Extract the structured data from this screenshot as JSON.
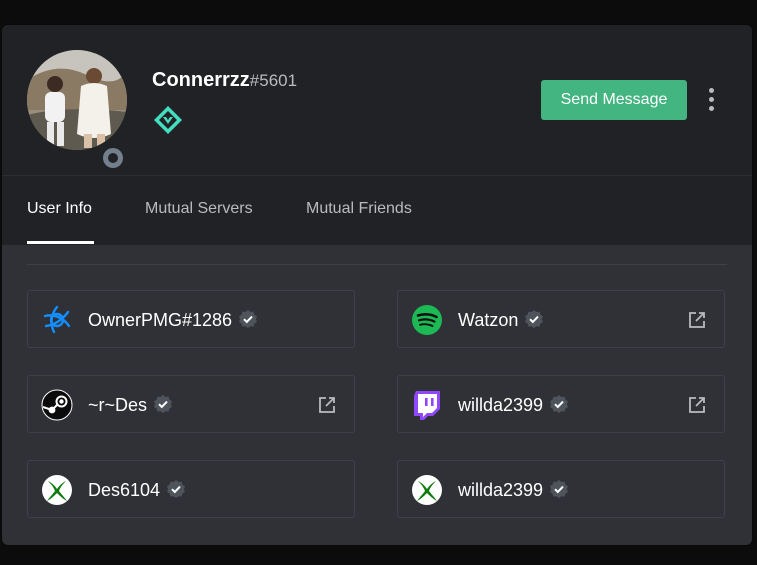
{
  "user": {
    "username": "Connerrzz",
    "discriminator": "#5601",
    "status": "offline",
    "badge_icon": "hypesquad-balance-icon"
  },
  "actions": {
    "send_message_label": "Send Message",
    "send_message_color": "#43b581"
  },
  "tabs": [
    {
      "label": "User Info",
      "active": true
    },
    {
      "label": "Mutual Servers",
      "active": false
    },
    {
      "label": "Mutual Friends",
      "active": false
    }
  ],
  "connections": [
    {
      "platform": "battlenet",
      "icon": "battlenet-icon",
      "name": "OwnerPMG#1286",
      "verified": true,
      "external_link": false
    },
    {
      "platform": "spotify",
      "icon": "spotify-icon",
      "name": "Watzon",
      "verified": true,
      "external_link": true
    },
    {
      "platform": "steam",
      "icon": "steam-icon",
      "name": "~r~Des",
      "verified": true,
      "external_link": true
    },
    {
      "platform": "twitch",
      "icon": "twitch-icon",
      "name": "willda2399",
      "verified": true,
      "external_link": true
    },
    {
      "platform": "xbox",
      "icon": "xbox-icon",
      "name": "Des6104",
      "verified": true,
      "external_link": false
    },
    {
      "platform": "xbox",
      "icon": "xbox-icon",
      "name": "willda2399",
      "verified": true,
      "external_link": false
    }
  ],
  "colors": {
    "header_bg": "#202225",
    "body_bg": "#2f3136",
    "card_border": "#3e4147",
    "spotify": "#1db954",
    "twitch": "#9146ff",
    "battlenet": "#148eff",
    "xbox": "#107c10",
    "hypesquad_balance": "#45ddc0",
    "offline": "#747f8d"
  }
}
